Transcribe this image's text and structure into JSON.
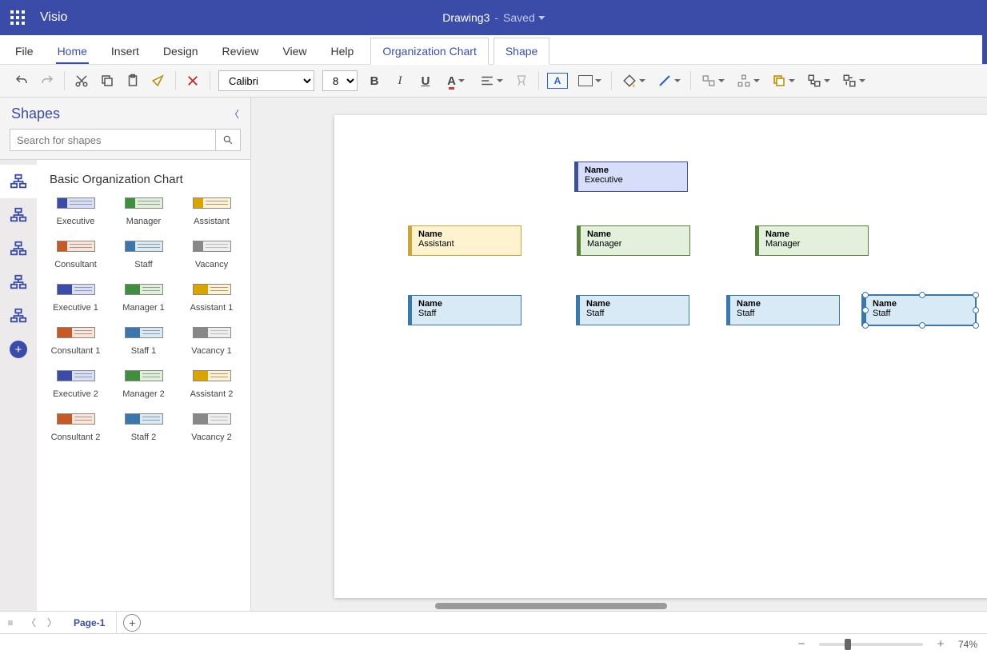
{
  "app": {
    "name": "Visio"
  },
  "document": {
    "name": "Drawing3",
    "status": "Saved"
  },
  "tabs": {
    "file": "File",
    "home": "Home",
    "insert": "Insert",
    "design": "Design",
    "review": "Review",
    "view": "View",
    "help": "Help",
    "ctx_org": "Organization Chart",
    "ctx_shape": "Shape"
  },
  "ribbon": {
    "font_name": "Calibri",
    "font_size": "8"
  },
  "shapes_panel": {
    "title": "Shapes",
    "search_placeholder": "Search for shapes",
    "stencil_title": "Basic Organization Chart",
    "items": [
      {
        "label": "Executive",
        "cls": "thumb-exec"
      },
      {
        "label": "Manager",
        "cls": "thumb-mgr"
      },
      {
        "label": "Assistant",
        "cls": "thumb-asst"
      },
      {
        "label": "Consultant",
        "cls": "thumb-cons"
      },
      {
        "label": "Staff",
        "cls": "thumb-staff"
      },
      {
        "label": "Vacancy",
        "cls": "thumb-vac"
      },
      {
        "label": "Executive 1",
        "cls": "thumb-exec thumb-split"
      },
      {
        "label": "Manager 1",
        "cls": "thumb-mgr thumb-split"
      },
      {
        "label": "Assistant 1",
        "cls": "thumb-asst thumb-split"
      },
      {
        "label": "Consultant 1",
        "cls": "thumb-cons thumb-split"
      },
      {
        "label": "Staff 1",
        "cls": "thumb-staff thumb-split"
      },
      {
        "label": "Vacancy 1",
        "cls": "thumb-vac thumb-split"
      },
      {
        "label": "Executive 2",
        "cls": "thumb-exec thumb-split"
      },
      {
        "label": "Manager 2",
        "cls": "thumb-mgr thumb-split"
      },
      {
        "label": "Assistant 2",
        "cls": "thumb-asst thumb-split"
      },
      {
        "label": "Consultant 2",
        "cls": "thumb-cons thumb-split"
      },
      {
        "label": "Staff 2",
        "cls": "thumb-staff thumb-split"
      },
      {
        "label": "Vacancy 2",
        "cls": "thumb-vac thumb-split"
      }
    ]
  },
  "canvas": {
    "nodes": {
      "exec": {
        "name": "Name",
        "title": "Executive"
      },
      "asst": {
        "name": "Name",
        "title": "Assistant"
      },
      "mg1": {
        "name": "Name",
        "title": "Manager"
      },
      "mg2": {
        "name": "Name",
        "title": "Manager"
      },
      "st1": {
        "name": "Name",
        "title": "Staff"
      },
      "st2": {
        "name": "Name",
        "title": "Staff"
      },
      "st3": {
        "name": "Name",
        "title": "Staff"
      },
      "st4": {
        "name": "Name",
        "title": "Staff"
      }
    }
  },
  "pagebar": {
    "page1": "Page-1"
  },
  "status": {
    "zoom": "74%"
  }
}
